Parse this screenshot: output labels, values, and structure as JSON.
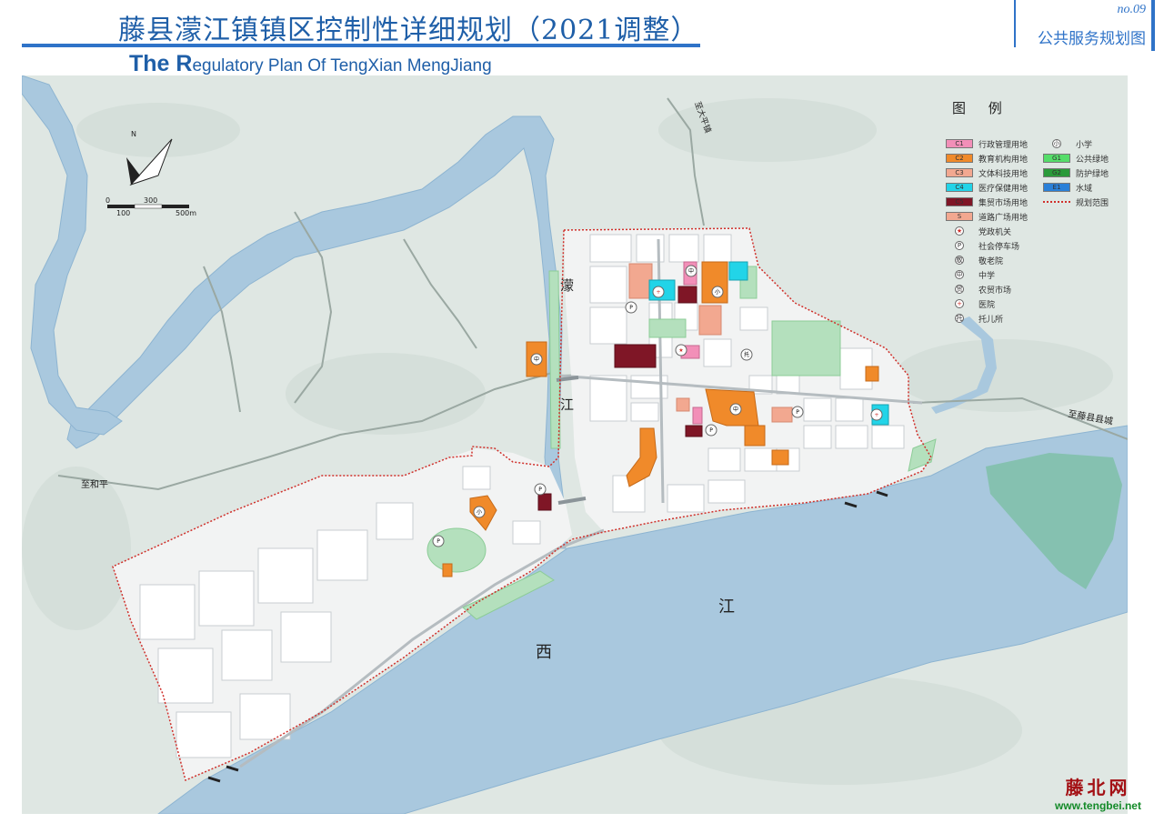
{
  "header": {
    "title_zh": "藤县濛江镇镇区控制性详细规划（2021调整）",
    "title_en_first": "The R",
    "title_en_rest": "egulatory Plan  Of  TengXian MengJiang",
    "sheet_no": "no.09",
    "sheet_name": "公共服务规划图"
  },
  "map": {
    "labels": {
      "river_meng_1": "濛",
      "river_meng_2": "江",
      "river_xi_1": "西",
      "river_xi_2": "江",
      "road_dali": "至大平镇",
      "road_tengxian": "至藤县县城",
      "road_heping": "至和平"
    },
    "north": "N",
    "scale": {
      "t0": "0",
      "t300": "300",
      "t100": "100",
      "t500": "500m"
    },
    "colors": {
      "background": "#dfe7e3",
      "river": "#a9c8de",
      "plan_area": "#f2f3f3",
      "green": "#b4e0bd",
      "education": "#f08a2a",
      "culture": "#f2a890",
      "market": "#7f1626",
      "admin": "#f28fb8",
      "medical": "#22d4e8",
      "boundary": "#d0302b"
    }
  },
  "legend": {
    "title": "图  例",
    "left": [
      {
        "code": "C1",
        "label": "行政管理用地",
        "color": "#f28fb8"
      },
      {
        "code": "C2",
        "label": "教育机构用地",
        "color": "#f08a2a"
      },
      {
        "code": "C3",
        "label": "文体科技用地",
        "color": "#f2a890"
      },
      {
        "code": "C4",
        "label": "医疗保健用地",
        "color": "#22d4e8"
      },
      {
        "code": "C5",
        "label": "集贸市场用地",
        "color": "#7f1626"
      },
      {
        "code": "S",
        "label": "道路广场用地",
        "color": "#f2a890"
      },
      {
        "sym": "★",
        "label": "党政机关"
      },
      {
        "sym": "P",
        "label": "社会停车场"
      },
      {
        "sym": "敬",
        "label": "敬老院"
      },
      {
        "sym": "中",
        "label": "中学"
      },
      {
        "sym": "贸",
        "label": "农贸市场"
      },
      {
        "sym": "+",
        "label": "医院"
      },
      {
        "sym": "托",
        "label": "托儿所"
      }
    ],
    "right": [
      {
        "sym": "小",
        "label": "小学"
      },
      {
        "code": "G1",
        "label": "公共绿地",
        "color": "#55dd6a"
      },
      {
        "code": "G2",
        "label": "防护绿地",
        "color": "#2a9a3a"
      },
      {
        "code": "E1",
        "label": "水域",
        "color": "#2a80d8"
      },
      {
        "dash": true,
        "label": "规划范围"
      }
    ]
  },
  "watermark": {
    "line1": "藤北网",
    "line2": "www.tengbei.net"
  }
}
